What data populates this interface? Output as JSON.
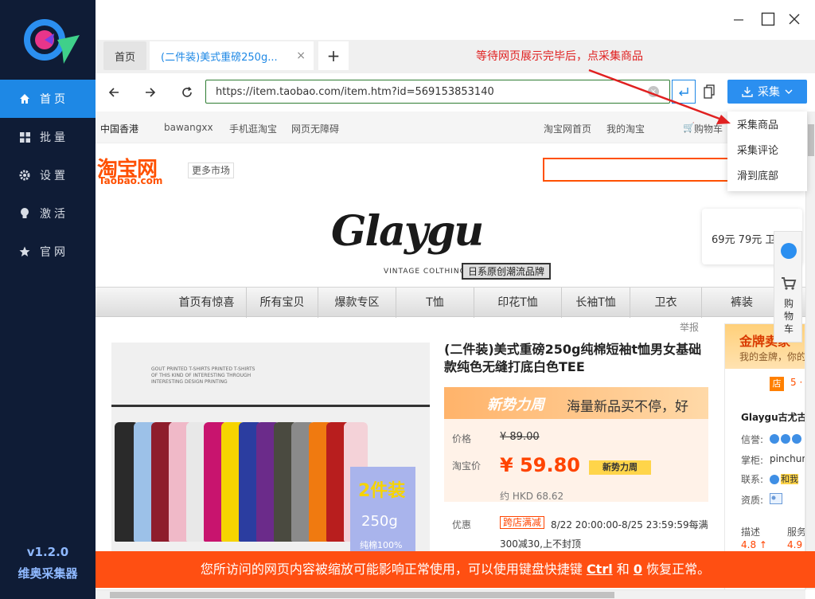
{
  "sidebar": {
    "items": [
      {
        "label": "首页",
        "icon": "home-icon"
      },
      {
        "label": "批量",
        "icon": "grid-icon"
      },
      {
        "label": "设置",
        "icon": "gear-icon"
      },
      {
        "label": "激活",
        "icon": "lightbulb-icon"
      },
      {
        "label": "官网",
        "icon": "star-icon"
      }
    ],
    "version": "v1.2.0",
    "app_name": "维奥采集器"
  },
  "tabs": {
    "home": "首页",
    "active": "(二件装)美式重磅250g...",
    "close": "×",
    "add": "+"
  },
  "annotation": "等待网页展示完毕后，点采集商品",
  "address_bar": {
    "url": "https://item.taobao.com/item.htm?id=569153853140"
  },
  "collect": {
    "label": "采集",
    "menu": [
      "采集商品",
      "采集评论",
      "滑到底部"
    ]
  },
  "site_bar": {
    "left": [
      "中国香港",
      "bawangxx",
      "手机逛淘宝",
      "网页无障碍"
    ],
    "right": [
      "淘宝网首页",
      "我的淘宝",
      "购物车"
    ]
  },
  "taobao": {
    "logo_cn": "淘宝网",
    "logo_en": "Taobao.com",
    "more_markets": "更多市场"
  },
  "banner": {
    "brand": "Glaygu",
    "sub": "VINTAGE COLTHING",
    "tag": "日系原创潮流品牌",
    "promo": "69元 79元 卫"
  },
  "shop_nav": [
    "首页有惊喜",
    "所有宝贝",
    "爆款专区",
    "T恤",
    "印花T恤",
    "长袖T恤",
    "卫衣",
    "裤装"
  ],
  "report": "举报",
  "float_cart": "购物车",
  "product": {
    "gallery_text": "GOUT PRINTED T-SHIRTS PRINTED T-SHIRTS OF THIS KIND OF INTERESTING THROUGH INTERESTING DESIGN PRINTING",
    "badge_pieces": "2件装",
    "badge_weight": "250g",
    "badge_cotton": "纯棉100%",
    "title": "(二件装)美式重磅250g纯棉短袖t恤男女基础款纯色无缝打底白色TEE",
    "new_week": "新势力周",
    "new_slogan": "海量新品买不停，好",
    "price_label": "价格",
    "price_old": "¥ 89.00",
    "sale_label": "淘宝价",
    "price_new": "¥ 59.80",
    "price_tag": "新势力周",
    "price_hkd": "约 HKD 68.62",
    "promo_label": "优惠",
    "promo_tag": "跨店满减",
    "promo_text": "8/22 20:00:00-8/25 23:59:59每满",
    "promo_text2": "300减30,上不封顶"
  },
  "shop": {
    "gold_title": "金牌卖家",
    "gold_sub": "我的金牌，你的",
    "store_tag": "店",
    "store_five": "5 ·",
    "name": "Glaygu古尤古",
    "reputation_label": "信誉:",
    "keeper_label": "掌柜:",
    "keeper_value": "pinchun",
    "contact_label": "联系:",
    "contact_tag": "和我",
    "qualification_label": "资质:",
    "desc_label": "描述",
    "desc_score": "4.8 ↑",
    "service_label": "服务",
    "service_score": "4.9"
  },
  "warning": {
    "before": "您所访问的网页内容被缩放可能影响正常使用，可以使用键盘快捷键",
    "key1": "Ctrl",
    "mid": "和",
    "key2": "0",
    "after": "恢复正常。"
  },
  "colors": {
    "sidebar_bg": "#0f1c36",
    "accent": "#1e88e5",
    "taobao_orange": "#ff5000",
    "warning_bg": "#ff4f12",
    "annotation_red": "#e02020"
  }
}
